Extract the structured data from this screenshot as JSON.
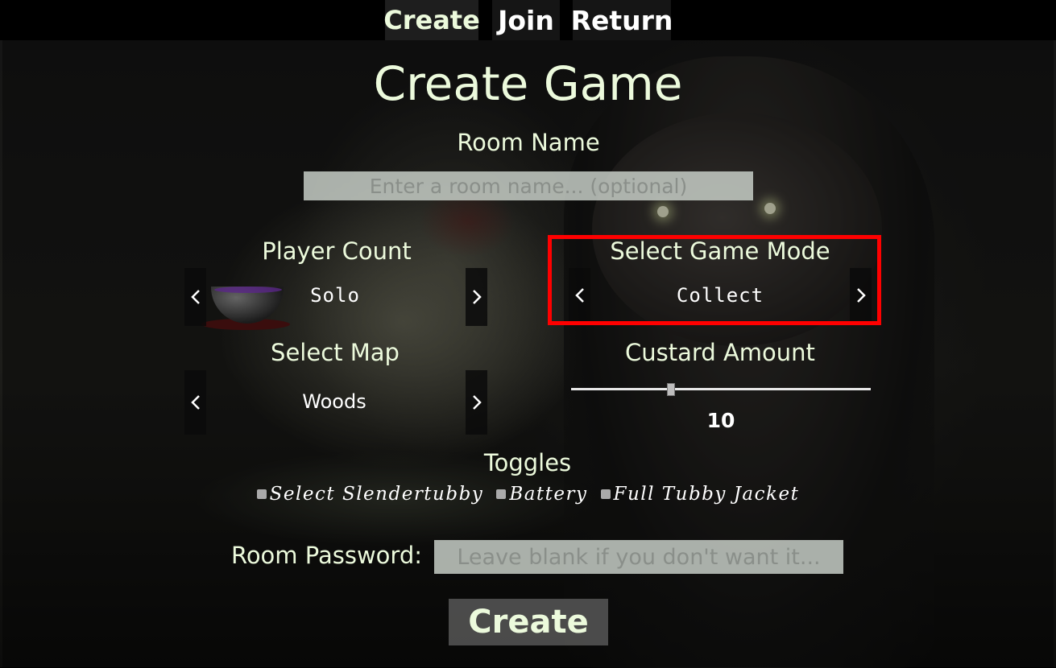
{
  "tabs": [
    {
      "label": "Create",
      "active": true
    },
    {
      "label": "Join",
      "active": false
    },
    {
      "label": "Return",
      "active": false
    }
  ],
  "title": "Create Game",
  "room_name": {
    "label": "Room Name",
    "placeholder": "Enter a room name... (optional)",
    "value": ""
  },
  "player_count": {
    "label": "Player Count",
    "value": "Solo"
  },
  "game_mode": {
    "label": "Select Game Mode",
    "value": "Collect",
    "highlighted": true,
    "highlight_color": "#ff0000"
  },
  "map": {
    "label": "Select Map",
    "value": "Woods"
  },
  "custard_amount": {
    "label": "Custard Amount",
    "value": "10",
    "fraction": 0.33
  },
  "toggles": {
    "label": "Toggles",
    "items": [
      {
        "label": "Select Slendertubby",
        "checked": false
      },
      {
        "label": "Battery",
        "checked": false
      },
      {
        "label": "Full Tubby Jacket",
        "checked": false
      }
    ]
  },
  "room_password": {
    "label": "Room Password:",
    "placeholder": "Leave blank if you don't want it...",
    "value": ""
  },
  "create_button": "Create",
  "icons": {
    "prev": "chevron-left-icon",
    "next": "chevron-right-icon"
  },
  "colors": {
    "text_accent": "#ecfadc",
    "input_bg": "#cdd4cd"
  }
}
